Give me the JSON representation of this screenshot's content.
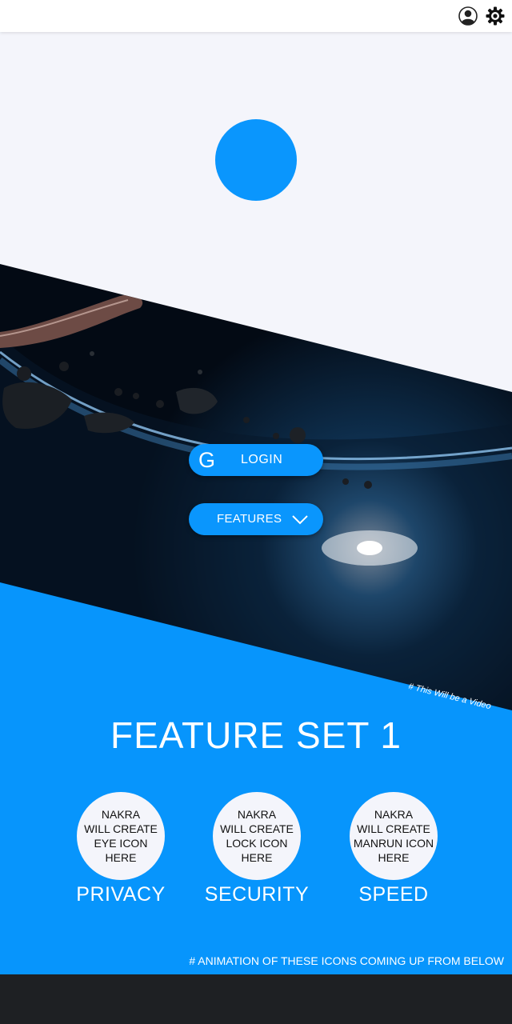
{
  "topbar": {
    "user_icon": "user-circle-icon",
    "settings_icon": "gear-icon"
  },
  "hero": {
    "video_note": "# This Will be a Video",
    "login_button": {
      "icon": "google-g-icon",
      "icon_glyph": "G",
      "label": "LOGIN"
    },
    "features_button": {
      "label": "FEATURES",
      "icon": "chevron-down-icon"
    }
  },
  "feature_set": {
    "title": "FEATURE SET 1",
    "items": [
      {
        "placeholder": "NAKRA\nWILL CREATE\nEYE ICON\nHERE",
        "label": "PRIVACY"
      },
      {
        "placeholder": "NAKRA\nWILL CREATE\nLOCK ICON\nHERE",
        "label": "SECURITY"
      },
      {
        "placeholder": "NAKRA\nWILL CREATE\nMANRUN ICON\nHERE",
        "label": "SPEED"
      }
    ],
    "animation_note": "# ANIMATION OF THESE ICONS COMING UP FROM BELOW"
  },
  "colors": {
    "accent": "#0795fc",
    "background": "#f4f5fb",
    "footer": "#1e2023"
  }
}
